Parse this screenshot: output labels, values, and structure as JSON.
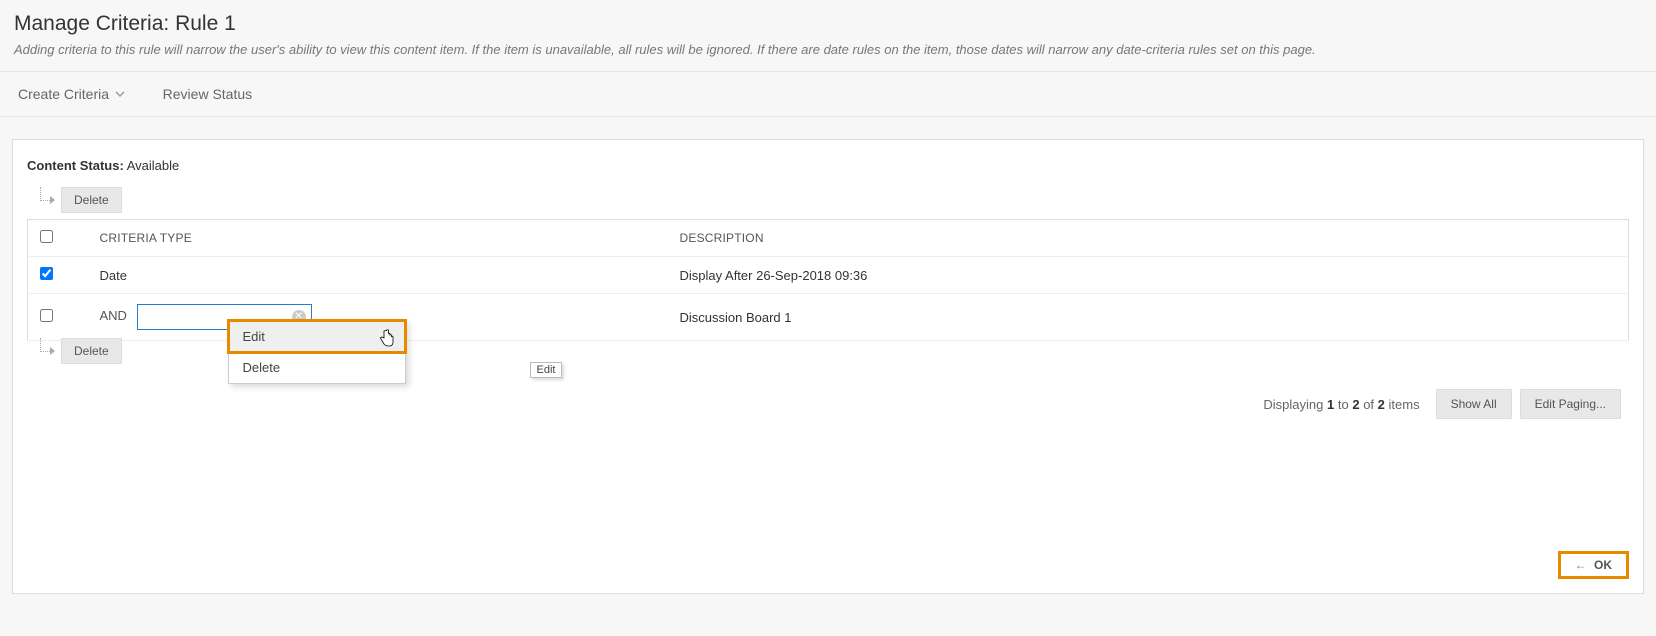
{
  "header": {
    "title": "Manage Criteria: Rule 1",
    "subtitle": "Adding criteria to this rule will narrow the user's ability to view this content item. If the item is unavailable, all rules will be ignored. If there are date rules on the item, those dates will narrow any date-criteria rules set on this page."
  },
  "toolbar": {
    "create_criteria": "Create Criteria",
    "review_status": "Review Status"
  },
  "status": {
    "label": "Content Status:",
    "value": "Available"
  },
  "buttons": {
    "delete": "Delete",
    "show_all": "Show All",
    "edit_paging": "Edit Paging...",
    "ok": "OK"
  },
  "table": {
    "headers": {
      "criteria_type": "CRITERIA TYPE",
      "description": "DESCRIPTION"
    },
    "rows": [
      {
        "checked": true,
        "prefix": "",
        "type": "Date",
        "description": "Display After 26-Sep-2018 09:36"
      },
      {
        "checked": false,
        "prefix": "AND",
        "type": "",
        "description": "Discussion Board 1"
      }
    ]
  },
  "dropdown": {
    "edit": "Edit",
    "delete": "Delete",
    "tooltip": "Edit"
  },
  "paging": {
    "prefix": "Displaying",
    "from": "1",
    "to_word": "to",
    "to": "2",
    "of_word": "of",
    "total": "2",
    "suffix": "items"
  }
}
